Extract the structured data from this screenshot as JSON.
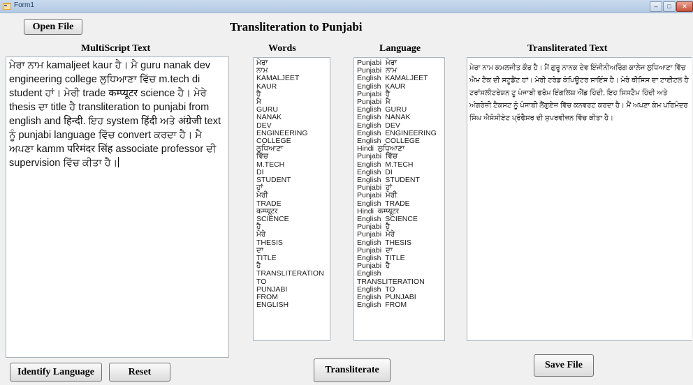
{
  "window": {
    "title": "Form1"
  },
  "buttons": {
    "open_file": "Open File",
    "identify_language": "Identify Language",
    "reset": "Reset",
    "transliterate": "Transliterate",
    "save_file": "Save File"
  },
  "headings": {
    "main": "Transliteration to Punjabi",
    "multiscript": "MultiScript Text",
    "words": "Words",
    "language": "Language",
    "transliterated": "Transliterated Text"
  },
  "input_text": "ਮੇਰਾ ਨਾਮ kamaljeet kaur ਹੈ। ਮੈ guru nanak dev engineering college ਲੁਧਿਆਣਾ ਵਿੱਚ m.tech di student ਹਾਂ। ਮੇਰੀ trade कम्प्यूटर science ਹੈ। ਮੇਰੇ thesis ਦਾ title ਹੈ transliteration to punjabi from english and हिन्दी. ਇਹ system हिंदी ਅਤੇ अंग्रेजी text ਨੂੰ punjabi language ਵਿੱਚ convert ਕਰਦਾ ਹੈ। ਮੈ ਅਪਣਾ kamm परिमंदर सिंह associate professor ਦੀ supervision ਵਿੱਚ ਕੀਤਾ ਹੈ।",
  "words": [
    "ਮੇਰਾ",
    "ਨਾਮ",
    "KAMALJEET",
    "KAUR",
    "ਹੈ",
    "ਮੈ",
    "GURU",
    "NANAK",
    "DEV",
    "ENGINEERING",
    "COLLEGE",
    "ਲੁਧਿਆਣਾ",
    "ਵਿੱਚ",
    "M.TECH",
    "DI",
    "STUDENT",
    "ਹਾਂ",
    "ਮੇਰੀ",
    "TRADE",
    "कम्प्यूटर",
    "SCIENCE",
    "ਹੈ",
    "ਮੇਰੇ",
    "THESIS",
    "ਦਾ",
    "TITLE",
    "ਹੈ",
    "TRANSLITERATION",
    "TO",
    "PUNJABI",
    "FROM",
    "ENGLISH"
  ],
  "languages": [
    "Punjabi  ਮੇਰਾ",
    "Punjabi  ਨਾਮ",
    "English  KAMALJEET",
    "English  KAUR",
    "Punjabi  ਹੈ",
    "Punjabi  ਮੈ",
    "English  GURU",
    "English  NANAK",
    "English  DEV",
    "English  ENGINEERING",
    "English  COLLEGE",
    "Hindi  ਲੁਧਿਆਣਾ",
    "Punjabi  ਵਿੱਚ",
    "English  M.TECH",
    "English  DI",
    "English  STUDENT",
    "Punjabi  ਹਾਂ",
    "Punjabi  ਮੇਰੀ",
    "English  TRADE",
    "Hindi  कम्प्यूटर",
    "English  SCIENCE",
    "Punjabi  ਹੈ",
    "Punjabi  ਮੇਰੇ",
    "English  THESIS",
    "Punjabi  ਦਾ",
    "English  TITLE",
    "Punjabi  ਹੈ",
    "English",
    "TRANSLITERATION",
    "English  TO",
    "English  PUNJABI",
    "English  FROM"
  ],
  "output_text": "ਮੇਰਾ ਨਾਮ ਕਮਲਜੀਤ ਕੌਰ ਹੈ। ਮੈਂ ਗੁਰੂ ਨਾਨਕ ਦੇਵ ਇੰਜੀਨੀਅਰਿੰਗ ਕਾਲੇਜ ਲੁਧਿਆਣਾ ਵਿੱਚ ਐਮ ਟੈਕ ਦੀ ਸਟੂਡੈਂਟ ਹਾਂ। ਮੇਰੀ ਟਰੇਡ ਕੰਪਿਊਟਰ ਸਾਇੰਸ ਹੈ। ਮੇਰੇ ਥੀਸਿਸ ਦਾ ਟਾਈਟਲ ਹੈ ਟਰਾਂਸਲੀਟਰੇਸ਼ਨ ਟੂ ਪੰਜਾਬੀ ਫਰੋਮ ਇੰਗਲਿਸ਼ ਐਂਡ ਹਿੰਦੀ, ਇਹ ਸਿਸਟੈਮ ਹਿੰਦੀ ਅਤੇ ਅੰਗਰੇਜ਼ੀ ਟੈਕਸਟ ਨੂੰ ਪੰਜਾਬੀ ਲੈਂਗੁਏਜ ਵਿੱਚ ਕਨਵਰਟ ਕਰਦਾ ਹੈ। ਮੈਂ ਅਪਣਾ ਕੰਮ ਪਰਿਮੰਦਰ ਸਿੰਘ ਐਸੋਸੀਏਟ ਪ੍ਰੋਫੈਸਰ ਦੀ ਸੁਪਰਵੀਜ਼ਨ ਵਿੱਚ ਕੀਤਾ ਹੈ।"
}
